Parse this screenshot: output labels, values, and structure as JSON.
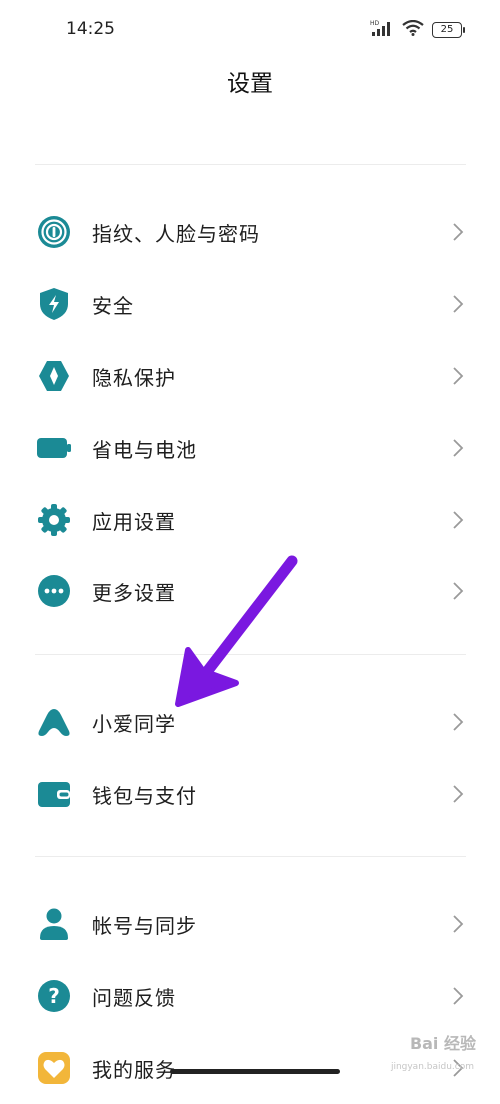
{
  "status": {
    "time": "14:25",
    "battery": "25",
    "network": "HD"
  },
  "header": {
    "title": "设置"
  },
  "colors": {
    "accent": "#1b8a95",
    "service": "#f2b63a",
    "arrow": "#7a18e0"
  },
  "sections": [
    {
      "items": [
        {
          "id": "fingerprint",
          "label": "指纹、人脸与密码",
          "icon": "fingerprint-icon"
        },
        {
          "id": "security",
          "label": "安全",
          "icon": "shield-bolt-icon"
        },
        {
          "id": "privacy",
          "label": "隐私保护",
          "icon": "privacy-icon"
        },
        {
          "id": "battery",
          "label": "省电与电池",
          "icon": "battery-icon"
        },
        {
          "id": "apps",
          "label": "应用设置",
          "icon": "gear-icon"
        },
        {
          "id": "more",
          "label": "更多设置",
          "icon": "more-dots-icon"
        }
      ]
    },
    {
      "items": [
        {
          "id": "xiaoai",
          "label": "小爱同学",
          "icon": "xiaoai-icon"
        },
        {
          "id": "wallet",
          "label": "钱包与支付",
          "icon": "wallet-icon"
        }
      ]
    },
    {
      "items": [
        {
          "id": "account",
          "label": "帐号与同步",
          "icon": "person-icon"
        },
        {
          "id": "feedback",
          "label": "问题反馈",
          "icon": "question-icon"
        },
        {
          "id": "services",
          "label": "我的服务",
          "icon": "heart-icon"
        }
      ]
    }
  ],
  "watermark": {
    "text": "Bai 经验",
    "sub": "jingyan.baidu.com"
  }
}
